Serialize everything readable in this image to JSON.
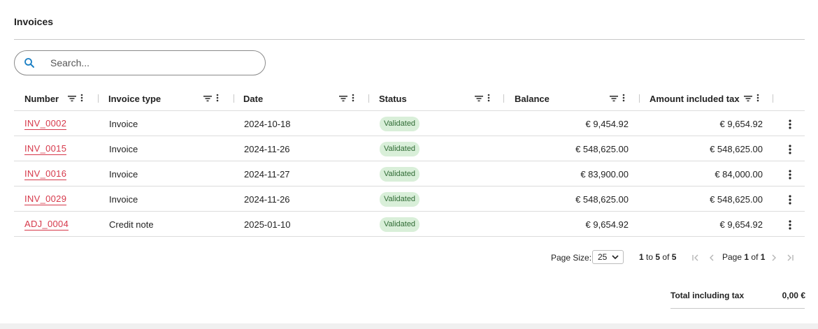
{
  "page": {
    "title": "Invoices"
  },
  "search": {
    "placeholder": "Search..."
  },
  "columns": [
    {
      "label": "Number"
    },
    {
      "label": "Invoice type"
    },
    {
      "label": "Date"
    },
    {
      "label": "Status"
    },
    {
      "label": "Balance"
    },
    {
      "label": "Amount included tax"
    }
  ],
  "rows": [
    {
      "number": "INV_0002",
      "type": "Invoice",
      "date": "2024-10-18",
      "status": "Validated",
      "balance": "€ 9,454.92",
      "amount": "€ 9,654.92"
    },
    {
      "number": "INV_0015",
      "type": "Invoice",
      "date": "2024-11-26",
      "status": "Validated",
      "balance": "€ 548,625.00",
      "amount": "€ 548,625.00"
    },
    {
      "number": "INV_0016",
      "type": "Invoice",
      "date": "2024-11-27",
      "status": "Validated",
      "balance": "€ 83,900.00",
      "amount": "€ 84,000.00"
    },
    {
      "number": "INV_0029",
      "type": "Invoice",
      "date": "2024-11-26",
      "status": "Validated",
      "balance": "€ 548,625.00",
      "amount": "€ 548,625.00"
    },
    {
      "number": "ADJ_0004",
      "type": "Credit note",
      "date": "2025-01-10",
      "status": "Validated",
      "balance": "€ 9,654.92",
      "amount": "€ 9,654.92"
    }
  ],
  "pagination": {
    "page_size_label": "Page Size:",
    "page_size": "25",
    "range_from": "1",
    "range_to_word": "to",
    "range_to": "5",
    "of_word": "of",
    "range_total": "5",
    "page_word": "Page",
    "page_current": "1",
    "page_of_word": "of",
    "page_total": "1"
  },
  "totals": {
    "label": "Total including tax",
    "value": "0,00 €"
  },
  "icons": {
    "search": "search-icon",
    "filter": "filter-icon",
    "column_menu": "vertical-dots-icon",
    "row_menu": "vertical-dots-icon",
    "first": "first-page-icon",
    "prev": "previous-page-icon",
    "next": "next-page-icon",
    "last": "last-page-icon",
    "dropdown": "chevron-down-icon"
  },
  "colors": {
    "link": "#d6384a",
    "badge_bg": "#d9efd9",
    "badge_text": "#2f6b34",
    "search_icon": "#1a7fc4"
  }
}
